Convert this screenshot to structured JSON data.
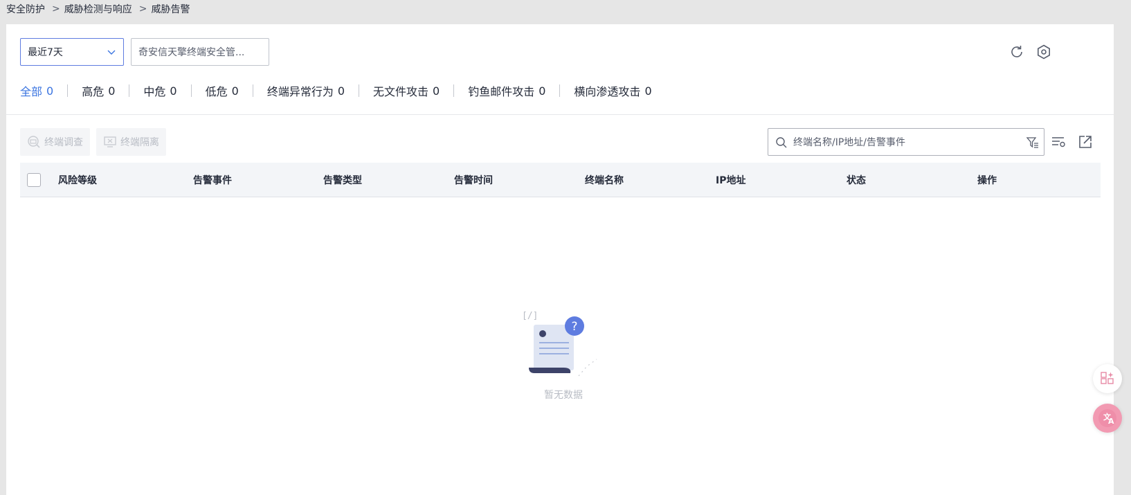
{
  "breadcrumb": {
    "items": [
      "安全防护",
      "威胁检测与响应",
      "威胁告警"
    ],
    "separator": ">"
  },
  "toolbar": {
    "time_range": "最近7天",
    "source_filter": "奇安信天擎终端安全管..."
  },
  "tabs": [
    {
      "label": "全部",
      "count": "0",
      "active": true
    },
    {
      "label": "高危",
      "count": "0"
    },
    {
      "label": "中危",
      "count": "0"
    },
    {
      "label": "低危",
      "count": "0"
    },
    {
      "label": "终端异常行为",
      "count": "0"
    },
    {
      "label": "无文件攻击",
      "count": "0"
    },
    {
      "label": "钓鱼邮件攻击",
      "count": "0"
    },
    {
      "label": "横向渗透攻击",
      "count": "0"
    }
  ],
  "actions": {
    "investigate": "终端调查",
    "isolate": "终端隔离"
  },
  "search": {
    "placeholder": "终端名称/IP地址/告警事件"
  },
  "table": {
    "columns": [
      "风险等级",
      "告警事件",
      "告警类型",
      "告警时间",
      "终端名称",
      "IP地址",
      "状态",
      "操作"
    ]
  },
  "empty": {
    "text": "暂无数据"
  },
  "colors": {
    "accent": "#3a74e0",
    "background": "#e6e6e6",
    "panel": "#ffffff",
    "disabled_text": "#b8bcc4"
  },
  "icons": [
    "refresh-icon",
    "gear-icon",
    "chevron-down-icon",
    "search-icon",
    "filter-icon",
    "column-settings-icon",
    "export-icon",
    "apps-icon",
    "translate-icon"
  ]
}
